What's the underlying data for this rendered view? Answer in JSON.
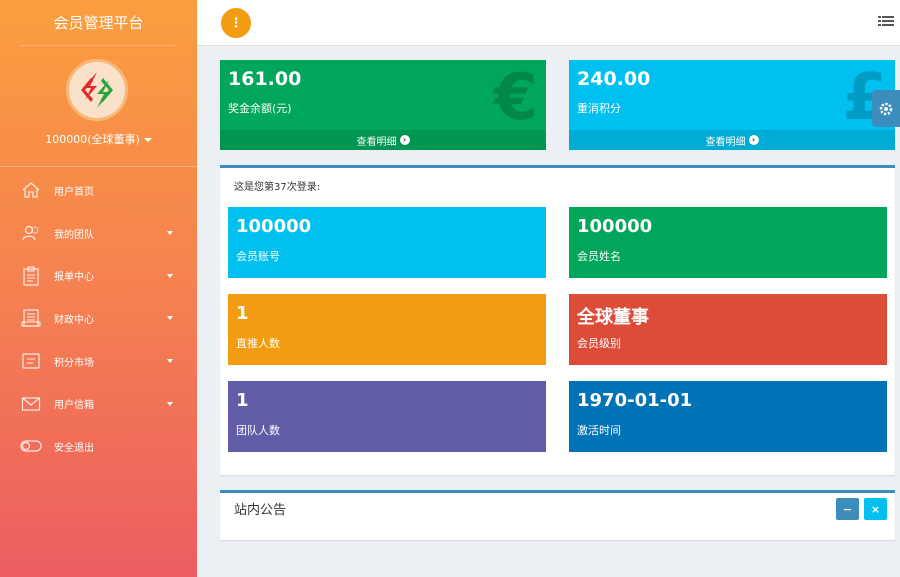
{
  "sidebar": {
    "brand": "会员管理平台",
    "user_label": "100000(全球董事)",
    "items": [
      {
        "label": "用户首页",
        "icon": "home-icon",
        "has_arrow": false
      },
      {
        "label": "我的团队",
        "icon": "team-icon",
        "has_arrow": true
      },
      {
        "label": "报单中心",
        "icon": "clipboard-icon",
        "has_arrow": true
      },
      {
        "label": "财政中心",
        "icon": "finance-icon",
        "has_arrow": true
      },
      {
        "label": "积分市场",
        "icon": "market-icon",
        "has_arrow": true
      },
      {
        "label": "用户信箱",
        "icon": "envelope-icon",
        "has_arrow": true
      },
      {
        "label": "安全退出",
        "icon": "toggle-icon",
        "has_arrow": false
      }
    ]
  },
  "topbar": {
    "toggle_glyph": "⋮",
    "list_icon": "list-icon"
  },
  "stats": [
    {
      "value": "161.00",
      "label": "奖金余额(元)",
      "footer": "查看明细",
      "symbol": "€",
      "color": "#00a65a"
    },
    {
      "value": "240.00",
      "label": "重消积分",
      "footer": "查看明细",
      "symbol": "£",
      "color": "#00c0ef"
    }
  ],
  "panel": {
    "login_text": "这是您第37次登录:",
    "tiles": [
      {
        "value": "100000",
        "label": "会员账号",
        "color": "#00c0ef"
      },
      {
        "value": "100000",
        "label": "会员姓名",
        "color": "#00a65a"
      },
      {
        "value": "1",
        "label": "直推人数",
        "color": "#f39c12"
      },
      {
        "value": "全球董事",
        "label": "会员级别",
        "color": "#dd4b39"
      },
      {
        "value": "1",
        "label": "团队人数",
        "color": "#605ca8"
      },
      {
        "value": "1970-01-01",
        "label": "激活时间",
        "color": "#0073b7"
      }
    ]
  },
  "notice": {
    "title": "站内公告",
    "collapse_glyph": "−",
    "close_glyph": "×"
  }
}
